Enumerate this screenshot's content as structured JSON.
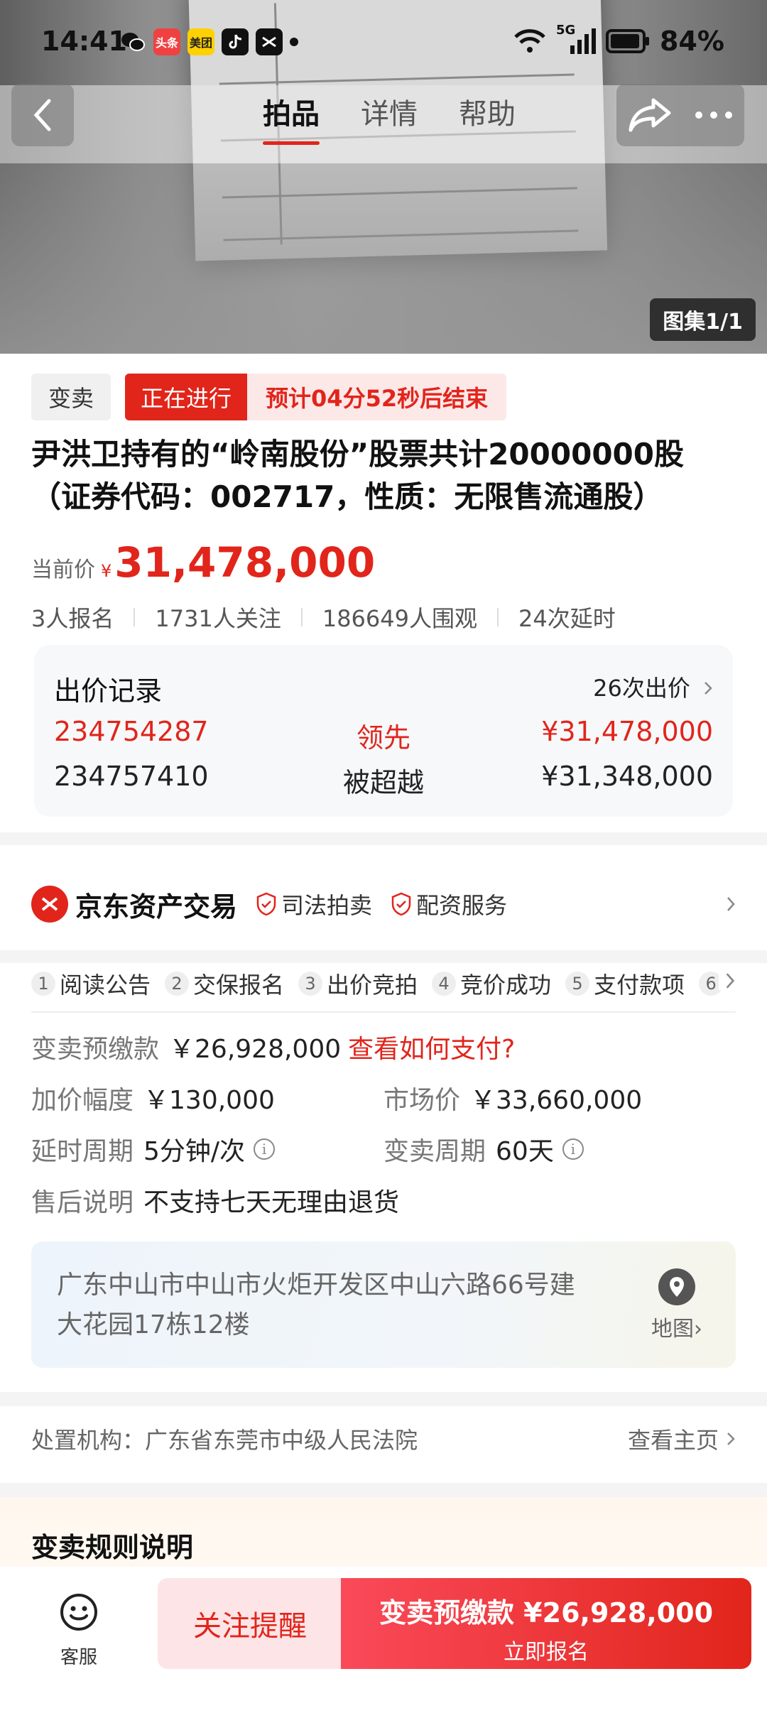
{
  "status_bar": {
    "time": "14:41",
    "apps": [
      "wechat-icon",
      "toutiao-icon",
      "meituan-icon",
      "tiktok-icon",
      "capcut-icon"
    ],
    "app_labels": {
      "toutiao": "头条",
      "meituan": "美团"
    },
    "network": "5G",
    "battery": "84%"
  },
  "nav": {
    "tabs": [
      "拍品",
      "详情",
      "帮助"
    ],
    "active_tab": 0
  },
  "gallery": {
    "label": "图集1/1"
  },
  "item": {
    "sale_type": "变卖",
    "status": "正在进行",
    "countdown": "预计04分52秒后结束",
    "title": "尹洪卫持有的“岭南股份”股票共计20000000股（证券代码：002717，性质：无限售流通股）",
    "price_label": "当前价",
    "price_currency": "¥",
    "price": "31,478,000"
  },
  "stats": [
    "3人报名",
    "1731人关注",
    "186649人围观",
    "24次延时"
  ],
  "bids": {
    "title": "出价记录",
    "count": "26次出价",
    "rows": [
      {
        "uid": "234754287",
        "state": "领先",
        "amount": "¥31,478,000"
      },
      {
        "uid": "234757410",
        "state": "被超越",
        "amount": "¥31,348,000"
      }
    ]
  },
  "platform": {
    "name": "京东资产交易",
    "tags": [
      "司法拍卖",
      "配资服务"
    ]
  },
  "steps": [
    {
      "num": "1",
      "label": "阅读公告"
    },
    {
      "num": "2",
      "label": "交保报名"
    },
    {
      "num": "3",
      "label": "出价竞拍"
    },
    {
      "num": "4",
      "label": "竞价成功"
    },
    {
      "num": "5",
      "label": "支付款项"
    },
    {
      "num": "6",
      "label": ""
    }
  ],
  "details": {
    "deposit_label": "变卖预缴款",
    "deposit_value": "￥26,928,000",
    "deposit_link": "查看如何支付?",
    "increment_label": "加价幅度",
    "increment_value": "￥130,000",
    "market_label": "市场价",
    "market_value": "￥33,660,000",
    "delay_label": "延时周期",
    "delay_value": "5分钟/次",
    "period_label": "变卖周期",
    "period_value": "60天",
    "aftersale_label": "售后说明",
    "aftersale_value": "不支持七天无理由退货"
  },
  "address": {
    "text": "广东中山市中山市火炬开发区中山六路66号建大花园17栋12楼",
    "map_label": "地图"
  },
  "court": {
    "label": "处置机构：广东省东莞市中级人民法院",
    "home_link": "查看主页"
  },
  "rules": {
    "title": "变卖规则说明"
  },
  "bottom": {
    "service_label": "客服",
    "follow_label": "关注提醒",
    "signup_line1": "变卖预缴款 ¥26,928,000",
    "signup_line2": "立即报名"
  },
  "colors": {
    "accent": "#e1251b",
    "accent_light": "#fde4e6"
  }
}
